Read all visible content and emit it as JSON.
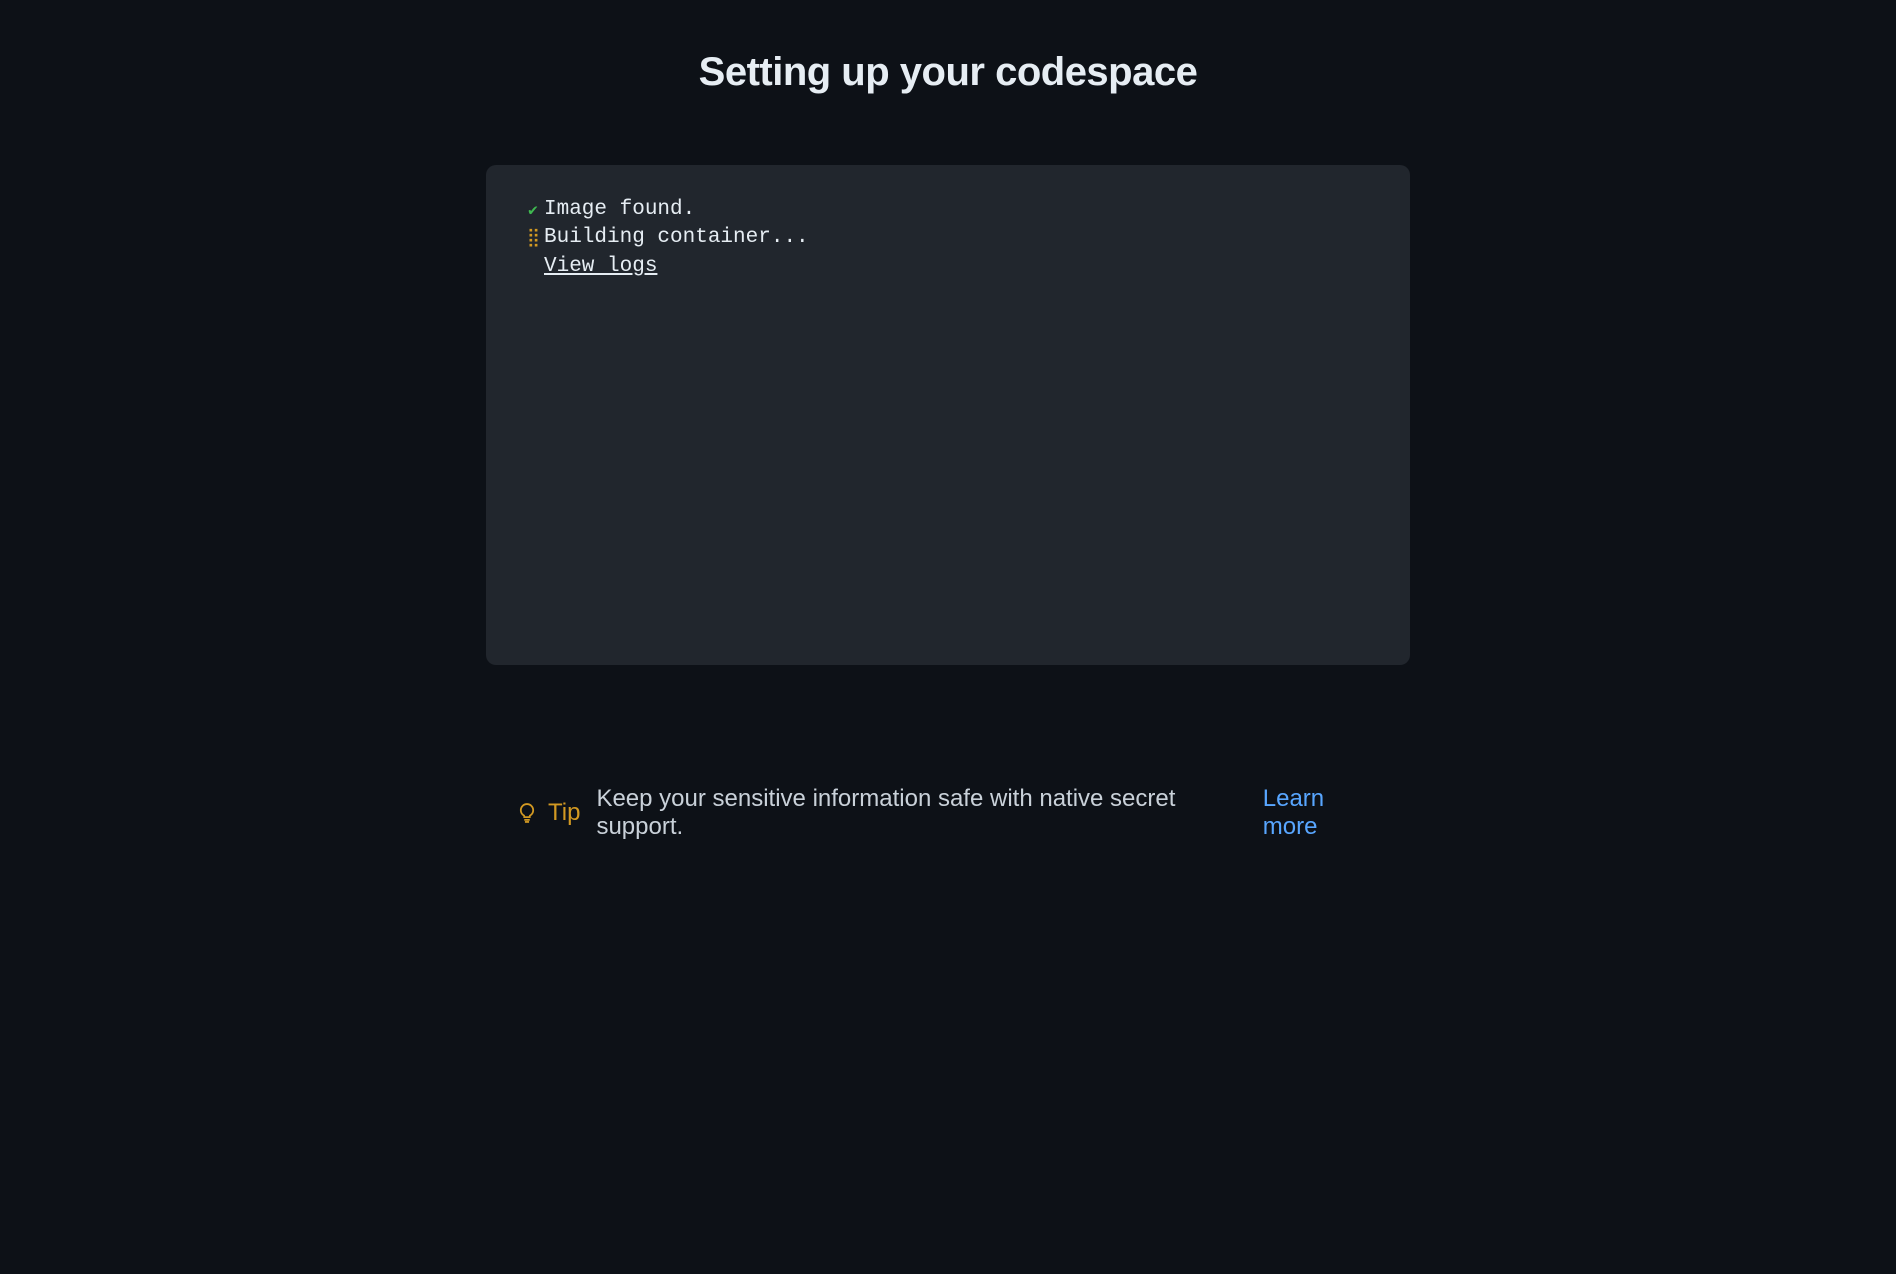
{
  "title": "Setting up your codespace",
  "logs": {
    "line1": "Image found.",
    "line2": "Building container...",
    "viewLogs": "View logs"
  },
  "tip": {
    "label": "Tip",
    "text": "Keep your sensitive information safe with native secret support.",
    "learnMore": "Learn more"
  }
}
